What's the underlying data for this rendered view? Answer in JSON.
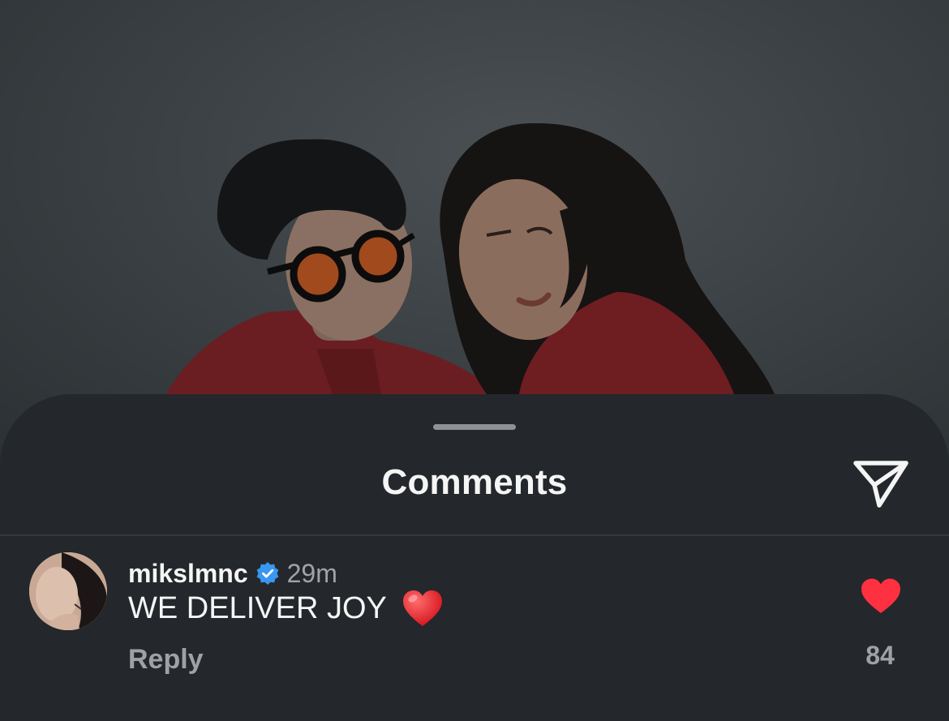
{
  "sheet": {
    "title": "Comments",
    "share_icon": "paper-plane-icon"
  },
  "comment": {
    "username": "mikslmnc",
    "verified": true,
    "verified_icon": "verified-badge-icon",
    "timestamp": "29m",
    "text": "WE DELIVER JOY",
    "emoji": "red-heart",
    "reply_label": "Reply",
    "liked": true,
    "like_icon": "heart-icon",
    "like_count": "84"
  },
  "colors": {
    "sheet_background": "#24272b",
    "like_red": "#ff3040",
    "verified_blue": "#3897f0",
    "primary_text": "#f5f5f5",
    "secondary_text": "#9ea2a6"
  }
}
